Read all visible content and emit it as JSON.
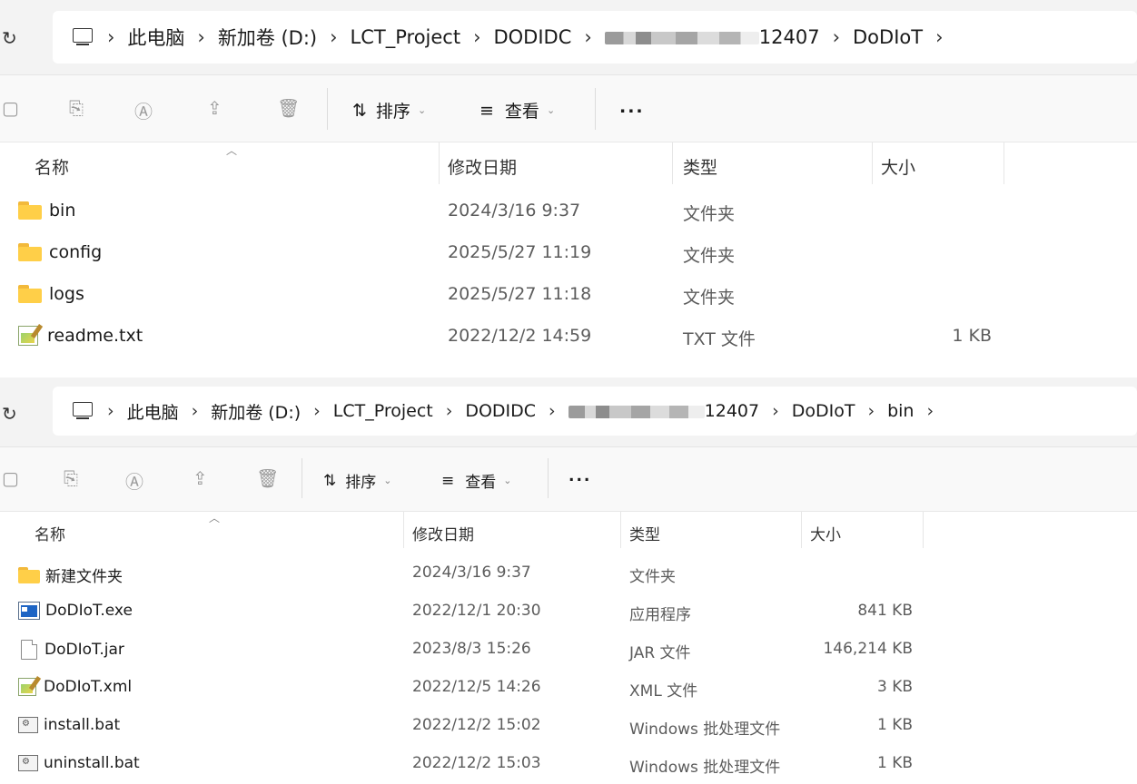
{
  "pane1": {
    "breadcrumb": [
      {
        "label": "此电脑"
      },
      {
        "label": "新加卷 (D:)"
      },
      {
        "label": "LCT_Project"
      },
      {
        "label": "DODIDC"
      },
      {
        "label": "12407",
        "blurred": true
      },
      {
        "label": "DoDIoT"
      }
    ],
    "toolbar": {
      "sort_label": "排序",
      "view_label": "查看",
      "more_label": "..."
    },
    "columns": {
      "name": "名称",
      "date": "修改日期",
      "type": "类型",
      "size": "大小"
    },
    "rows": [
      {
        "icon": "folder-icon",
        "name": "bin",
        "date": "2024/3/16 9:37",
        "type": "文件夹",
        "size": ""
      },
      {
        "icon": "folder-icon",
        "name": "config",
        "date": "2025/5/27 11:19",
        "type": "文件夹",
        "size": ""
      },
      {
        "icon": "folder-icon",
        "name": "logs",
        "date": "2025/5/27 11:18",
        "type": "文件夹",
        "size": ""
      },
      {
        "icon": "text-file-icon",
        "name": "readme.txt",
        "date": "2022/12/2 14:59",
        "type": "TXT 文件",
        "size": "1 KB"
      }
    ]
  },
  "pane2": {
    "breadcrumb": [
      {
        "label": "此电脑"
      },
      {
        "label": "新加卷 (D:)"
      },
      {
        "label": "LCT_Project"
      },
      {
        "label": "DODIDC"
      },
      {
        "label": "12407",
        "blurred": true
      },
      {
        "label": "DoDIoT"
      },
      {
        "label": "bin"
      }
    ],
    "toolbar": {
      "sort_label": "排序",
      "view_label": "查看",
      "more_label": "..."
    },
    "columns": {
      "name": "名称",
      "date": "修改日期",
      "type": "类型",
      "size": "大小"
    },
    "rows": [
      {
        "icon": "folder-icon",
        "name": "新建文件夹",
        "date": "2024/3/16 9:37",
        "type": "文件夹",
        "size": ""
      },
      {
        "icon": "exe-icon",
        "name": "DoDIoT.exe",
        "date": "2022/12/1 20:30",
        "type": "应用程序",
        "size": "841 KB"
      },
      {
        "icon": "file-icon",
        "name": "DoDIoT.jar",
        "date": "2023/8/3 15:26",
        "type": "JAR 文件",
        "size": "146,214 KB"
      },
      {
        "icon": "text-file-icon",
        "name": "DoDIoT.xml",
        "date": "2022/12/5 14:26",
        "type": "XML 文件",
        "size": "3 KB"
      },
      {
        "icon": "batch-file-icon",
        "name": "install.bat",
        "date": "2022/12/2 15:02",
        "type": "Windows 批处理文件",
        "size": "1 KB"
      },
      {
        "icon": "batch-file-icon",
        "name": "uninstall.bat",
        "date": "2022/12/2 15:03",
        "type": "Windows 批处理文件",
        "size": "1 KB"
      }
    ]
  }
}
